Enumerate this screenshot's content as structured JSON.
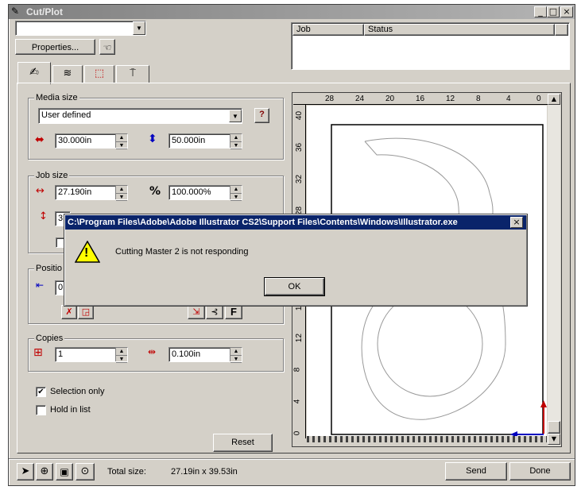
{
  "window": {
    "title": "Cut/Plot",
    "min": "_",
    "max": "□",
    "close": "×"
  },
  "top": {
    "device_value": "",
    "properties_label": "Properties..."
  },
  "jobs_list": {
    "col_job": "Job",
    "col_status": "Status"
  },
  "tabs": [
    {
      "icon": "pen-holder-icon"
    },
    {
      "icon": "layers-icon"
    },
    {
      "icon": "frame-icon"
    },
    {
      "icon": "cutter-tool-icon"
    }
  ],
  "media": {
    "group_label": "Media size",
    "preset": "User defined",
    "help": "?",
    "width": "30.000in",
    "length": "50.000in"
  },
  "job": {
    "group_label": "Job size",
    "width": "27.190in",
    "scale": "100.000%",
    "height_partial": "3"
  },
  "position": {
    "group_label": "Positio",
    "value_partial": "0",
    "f_button": "F"
  },
  "copies": {
    "group_label": "Copies",
    "count": "1",
    "spacing": "0.100in"
  },
  "options": {
    "selection_only": "Selection only",
    "selection_checked": "✔",
    "hold_in_list": "Hold in list"
  },
  "reset_label": "Reset",
  "ruler": {
    "top_ticks": [
      "28",
      "24",
      "20",
      "16",
      "12",
      "8",
      "4",
      "0"
    ],
    "left_ticks": [
      "40",
      "36",
      "32",
      "28",
      "24",
      "20",
      "16",
      "12",
      "8",
      "4",
      "0"
    ]
  },
  "bottom": {
    "total_label": "Total size:",
    "total_value": "27.19in x 39.53in",
    "send": "Send",
    "done": "Done"
  },
  "dialog": {
    "title": "C:\\Program Files\\Adobe\\Adobe Illustrator CS2\\Support Files\\Contents\\Windows\\Illustrator.exe",
    "message": "Cutting Master 2 is not responding",
    "ok": "OK",
    "warning_glyph": "!",
    "close": "×"
  }
}
